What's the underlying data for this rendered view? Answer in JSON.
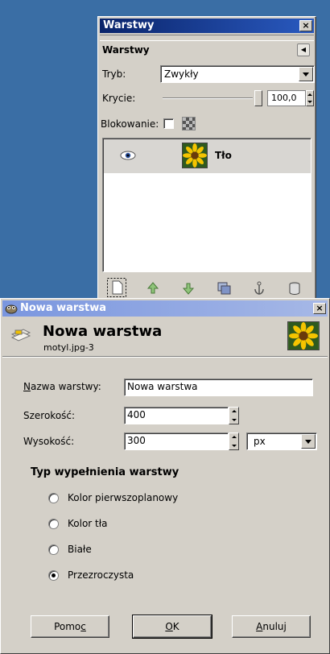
{
  "layers_dock": {
    "window_title": "Warstwy",
    "close_glyph": "×",
    "heading": "Warstwy",
    "mode_label": "Tryb:",
    "mode_value": "Zwykły",
    "opacity_label": "Krycie:",
    "opacity_value": "100,0",
    "opacity_fraction": 1.0,
    "lock_label": "Blokowanie:",
    "layers": [
      {
        "name": "Tło",
        "visible": true,
        "thumbnail": "sunflower-thumbnail"
      }
    ],
    "tools": [
      "new-layer-icon",
      "raise-layer-icon",
      "lower-layer-icon",
      "duplicate-layer-icon",
      "anchor-layer-icon",
      "delete-layer-icon"
    ]
  },
  "dialog": {
    "window_title": "Nowa warstwa",
    "close_glyph": "×",
    "header_title": "Nowa warstwa",
    "header_subtitle": "motyl.jpg-3",
    "name_label_accel": "N",
    "name_label_rest": "azwa warstwy:",
    "name_value": "Nowa warstwa",
    "width_label": "Szerokość:",
    "width_value": "400",
    "height_label": "Wysokość:",
    "height_value": "300",
    "unit_value": "px",
    "fill_heading": "Typ wypełnienia warstwy",
    "fill_options": [
      {
        "label": "Kolor pierwszoplanowy",
        "selected": false
      },
      {
        "label": "Kolor tła",
        "selected": false
      },
      {
        "label": "Białe",
        "selected": false
      },
      {
        "label": "Przezroczysta",
        "selected": true
      }
    ],
    "buttons": {
      "help_pre": "Pomo",
      "help_accel": "c",
      "ok_accel": "O",
      "ok_rest": "K",
      "cancel_accel": "A",
      "cancel_rest": "nuluj"
    }
  },
  "colors": {
    "desktop": "#3a6ea5",
    "titlebar_active": "#0a246a",
    "titlebar_inactive": "#7a96df",
    "window_face": "#d4d0c8"
  }
}
